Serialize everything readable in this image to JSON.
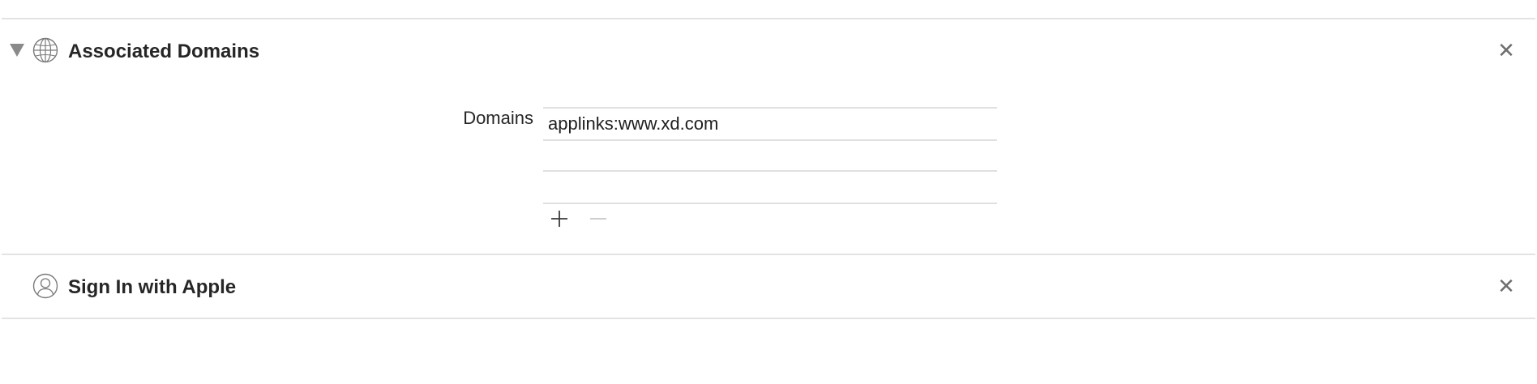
{
  "capabilities": [
    {
      "title": "Associated Domains",
      "icon": "globe-icon",
      "expanded": true,
      "close_glyph": "✕",
      "field": {
        "label": "Domains",
        "rows": [
          "applinks:www.xd.com",
          "",
          ""
        ],
        "add_glyph": "+",
        "remove_glyph": "−"
      }
    },
    {
      "title": "Sign In with Apple",
      "icon": "person-icon",
      "expanded": false,
      "close_glyph": "✕"
    }
  ],
  "colors": {
    "separator": "#e3e3e3",
    "text": "#262626",
    "secondary": "#6e6e6e",
    "disabled": "#c6c6c6"
  }
}
